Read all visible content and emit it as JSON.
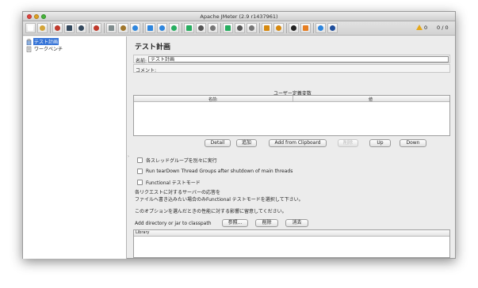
{
  "window": {
    "title": "Apache JMeter (2.9 r1437961)"
  },
  "toolbar": {
    "buttons": [
      {
        "icon": "new-icon",
        "color": "#ffffff"
      },
      {
        "icon": "templates-icon",
        "color": "#d4a53a"
      },
      {
        "icon": "open-icon",
        "color": "#c0392b"
      },
      {
        "icon": "save-icon",
        "color": "#34495e"
      },
      {
        "icon": "save-as-icon",
        "color": "#34495e"
      },
      {
        "icon": "cut-icon",
        "color": "#c0392b"
      },
      {
        "icon": "copy-icon",
        "color": "#7f8c8d"
      },
      {
        "icon": "paste-icon",
        "color": "#a0762b"
      },
      {
        "icon": "expand-icon",
        "color": "#2e86de"
      },
      {
        "icon": "collapse-icon",
        "color": "#2e86de"
      },
      {
        "icon": "toggle-icon",
        "color": "#2e86de"
      },
      {
        "icon": "start-icon",
        "color": "#27ae60"
      },
      {
        "icon": "start-no-pause-icon",
        "color": "#27ae60"
      },
      {
        "icon": "stop-icon",
        "color": "#555555"
      },
      {
        "icon": "shutdown-icon",
        "color": "#777777"
      },
      {
        "icon": "remote-start-icon",
        "color": "#27ae60"
      },
      {
        "icon": "remote-stop-icon",
        "color": "#555555"
      },
      {
        "icon": "remote-shutdown-icon",
        "color": "#777777"
      },
      {
        "icon": "clear-icon",
        "color": "#d68910"
      },
      {
        "icon": "clear-all-icon",
        "color": "#d68910"
      },
      {
        "icon": "search-icon",
        "color": "#222222"
      },
      {
        "icon": "reset-search-icon",
        "color": "#e67e22"
      },
      {
        "icon": "function-helper-icon",
        "color": "#2e86de"
      },
      {
        "icon": "help-icon",
        "color": "#1f4e9c"
      }
    ],
    "warning_count": "0",
    "thread_count": "0 / 0"
  },
  "tree": {
    "items": [
      {
        "label": "テスト計画",
        "icon": "test-plan-icon",
        "selected": true
      },
      {
        "label": "ワークベンチ",
        "icon": "workbench-icon",
        "selected": false
      }
    ]
  },
  "panel": {
    "title": "テスト計画",
    "name_label": "名前:",
    "name_value": "テスト計画",
    "comment_label": "コメント:",
    "user_vars_title": "ユーザー定義変数",
    "table_headers": [
      "名前:",
      "値"
    ],
    "buttons": {
      "detail": "Detail",
      "add": "追加",
      "add_clipboard": "Add from Clipboard",
      "delete": "削除",
      "up": "Up",
      "down": "Down"
    },
    "checks": [
      "各スレッドグループを別々に実行",
      "Run tearDown Thread Groups after shutdown of main threads",
      "Functional テストモード"
    ],
    "desc_line1": "各リクエストに対するサーバーの応答を",
    "desc_line2": "ファイルへ書き込みたい場合のみFunctional テストモードを選択して下さい。",
    "desc_line3": "このオプションを選んだときの性能に対する影響に留意してください。",
    "classpath_label": "Add directory or jar to classpath",
    "classpath_buttons": {
      "browse": "参照...",
      "delete": "削除",
      "clear": "消去"
    },
    "library_header": "Library"
  }
}
